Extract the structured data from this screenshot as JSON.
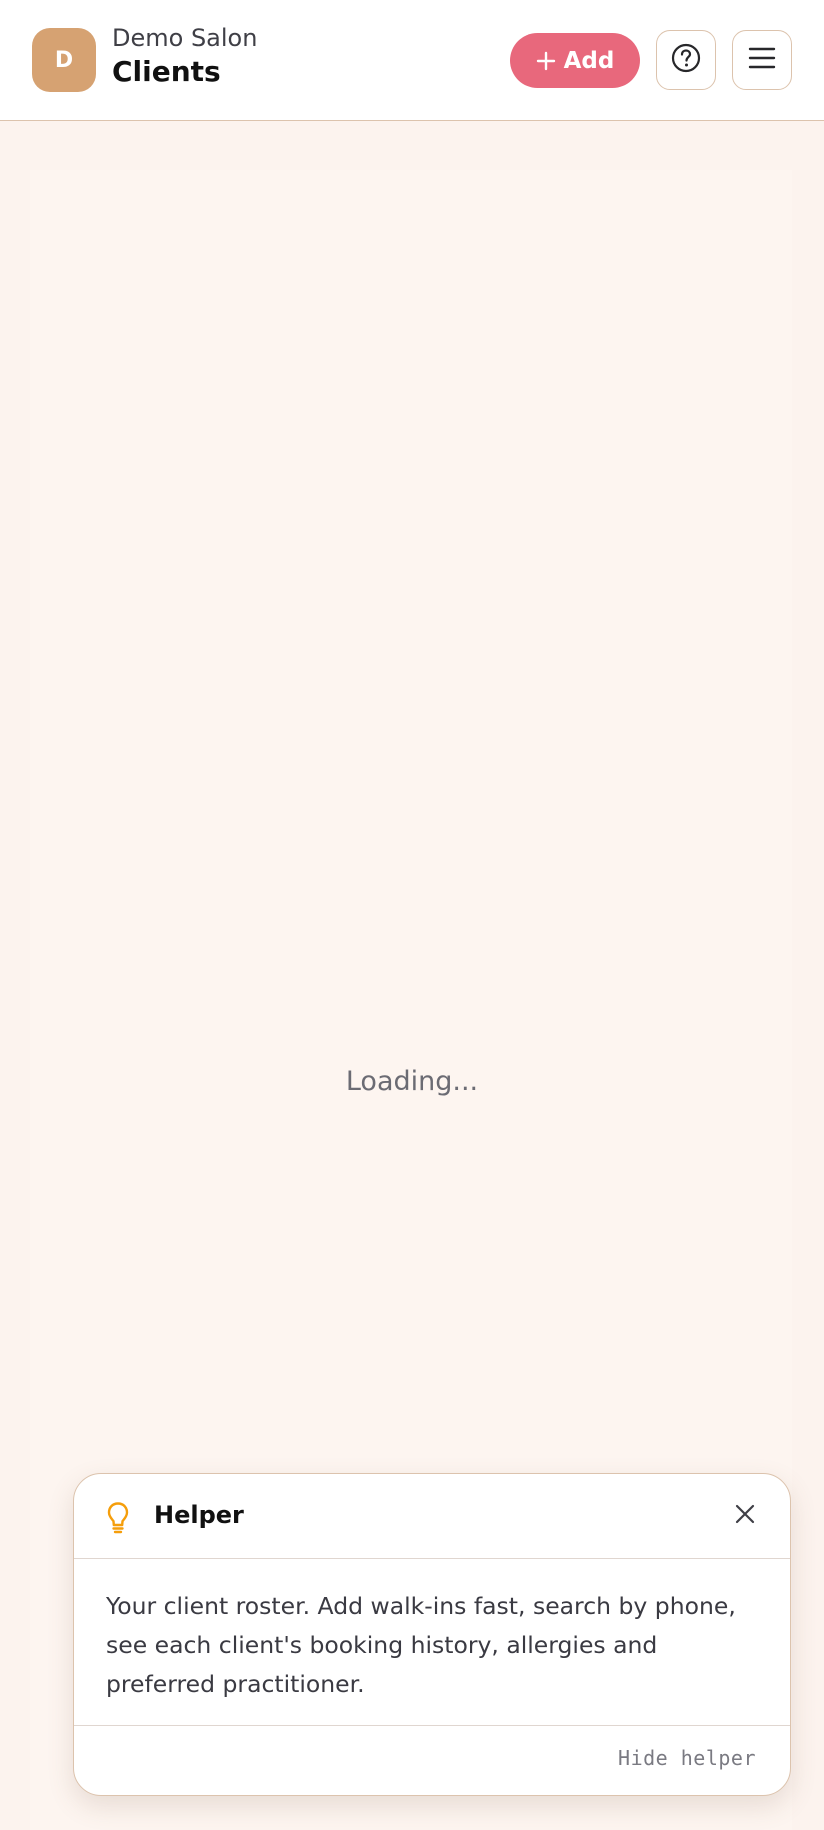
{
  "header": {
    "avatar_initial": "D",
    "salon_name": "Demo Salon",
    "page_title": "Clients",
    "add_label": "Add",
    "help_icon": "question-circle-icon",
    "menu_icon": "hamburger-menu-icon"
  },
  "main": {
    "loading_text": "Loading..."
  },
  "helper": {
    "icon": "lightbulb-icon",
    "title": "Helper",
    "body": "Your client roster. Add walk-ins fast, search by phone, see each client's booking history, allergies and preferred practitioner.",
    "hide_label": "Hide helper",
    "close_icon": "close-icon"
  },
  "colors": {
    "background": "#fcf3ee",
    "header_bg": "#ffffff",
    "avatar_bg": "#d6a272",
    "accent": "#e8687c",
    "border": "#dcc3ad",
    "bulb": "#f59e0b"
  }
}
